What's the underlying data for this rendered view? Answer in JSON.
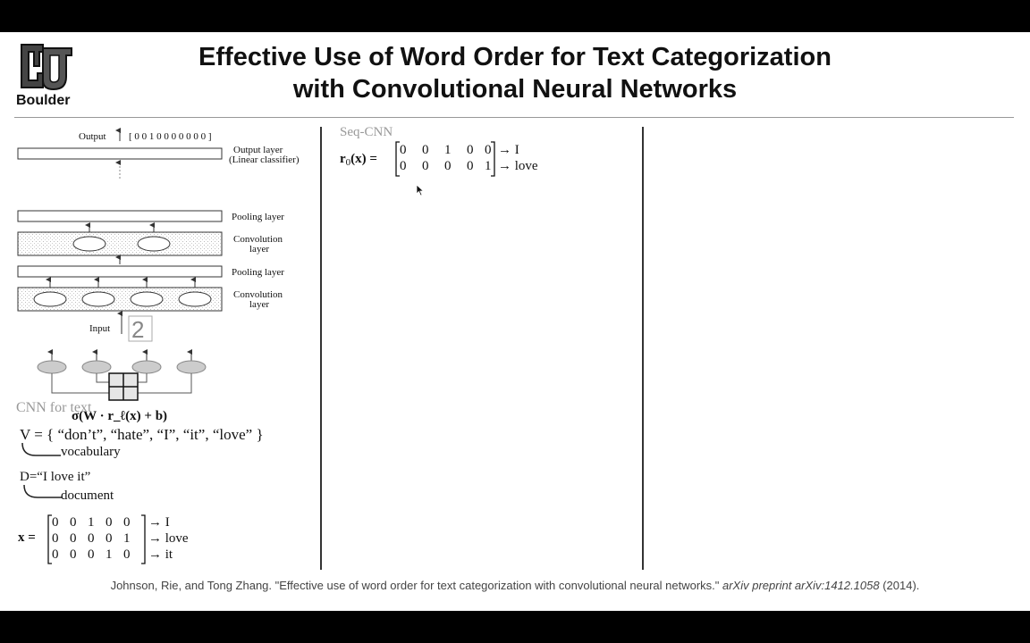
{
  "logo": {
    "text": "Boulder",
    "icon": "cu-boulder-logo"
  },
  "title": {
    "line1": "Effective Use of Word Order for Text Categorization",
    "line2": "with Convolutional Neural Networks"
  },
  "diagram": {
    "output_label": "Output",
    "output_vector": "[ 0 0 1 0 0 0 0 0 0 0 ]",
    "layers": {
      "output_1": "Output layer",
      "output_2": "(Linear classifier)",
      "pooling_top": "Pooling layer",
      "conv_top_1": "Convolution",
      "conv_top_2": "layer",
      "pooling_bottom": "Pooling layer",
      "conv_bottom_1": "Convolution",
      "conv_bottom_2": "layer"
    },
    "input_label": "Input",
    "input_digit": "2",
    "formula": "σ(W · r_ℓ(x) + b)"
  },
  "cnn_text": {
    "heading": "CNN for text",
    "vocab_eq": "V = { “don’t”, “hate”, “I”, “it”, “love” }",
    "vocab_label": "vocabulary",
    "doc_eq": "D=“I love it”",
    "doc_label": "document",
    "x_lhs": "x =",
    "x_rows": [
      {
        "cells": [
          "0",
          "0",
          "1",
          "0",
          "0"
        ],
        "word": "→ I"
      },
      {
        "cells": [
          "0",
          "0",
          "0",
          "0",
          "1"
        ],
        "word": "→ love"
      },
      {
        "cells": [
          "0",
          "0",
          "0",
          "1",
          "0"
        ],
        "word": "→ it"
      }
    ]
  },
  "seq_cnn": {
    "heading": "Seq-CNN",
    "lhs_r": "r",
    "lhs_sub": "0",
    "lhs_rest": "(x) =",
    "rows": [
      {
        "cells": [
          "0",
          "0",
          "1",
          "0",
          "0"
        ],
        "word": "→ I"
      },
      {
        "cells": [
          "0",
          "0",
          "0",
          "0",
          "1"
        ],
        "word": "→ love"
      }
    ]
  },
  "citation": {
    "authors": "Johnson, Rie, and Tong Zhang. \"Effective use of word order for text categorization with convolutional neural networks.\" ",
    "venue": "arXiv preprint arXiv:1412.1058",
    "year": " (2014)."
  }
}
